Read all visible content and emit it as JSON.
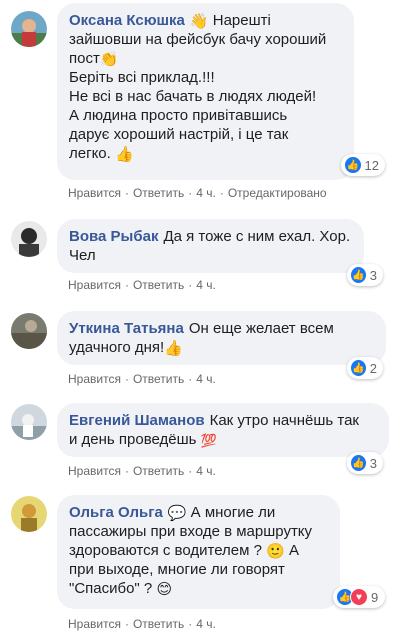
{
  "comments": [
    {
      "author": "Оксана Ксюшка",
      "text_line1_suffix": " Нарешті",
      "text_rest": "зайшовши на фейсбук бачу хороший\nпост",
      "text_after_clap": "\nБеріть всі приклад.!!!\nНе всі в нас бачать в людях людей!\nА людина просто привітавшись\nдарує хороший настрій, і це так\nлегко. ",
      "reaction_count": "12",
      "like": "Нравится",
      "reply": "Ответить",
      "time": "4 ч.",
      "edited": "Отредактировано"
    },
    {
      "author": "Вова Рыбак",
      "text": "Да я тоже с ним ехал. Хор.\nЧел",
      "reaction_count": "3",
      "like": "Нравится",
      "reply": "Ответить",
      "time": "4 ч."
    },
    {
      "author": "Уткина Татьяна",
      "text": "Он еще желает всем\nудачного дня!",
      "reaction_count": "2",
      "like": "Нравится",
      "reply": "Ответить",
      "time": "4 ч."
    },
    {
      "author": "Евгений Шаманов",
      "text": "Как утро начнёшь так\nи день проведёшь ",
      "reaction_count": "3",
      "like": "Нравится",
      "reply": "Ответить",
      "time": "4 ч."
    },
    {
      "author": "Ольга Ольга",
      "text_a": " А многие ли\nпассажиры при входе в маршрутку\nздороваются с водителем ? ",
      "text_b": " А\nпри выходе, многие ли говорят\n\"Спасибо\" ? ",
      "reaction_count": "9",
      "like": "Нравится",
      "reply": "Ответить",
      "time": "4 ч."
    }
  ],
  "icons": {
    "like": "like-icon",
    "love": "love-icon",
    "wave": "waving-hand-icon",
    "clap": "clapping-hands-icon",
    "thumbs": "thumbs-up-icon",
    "hundred": "hundred-points-icon",
    "smile": "smiling-face-icon",
    "speech": "speech-balloon-icon"
  },
  "colors": {
    "author": "#385898",
    "like": "#1877f2",
    "love": "#f33e58",
    "bubble": "#f0f2f5"
  }
}
